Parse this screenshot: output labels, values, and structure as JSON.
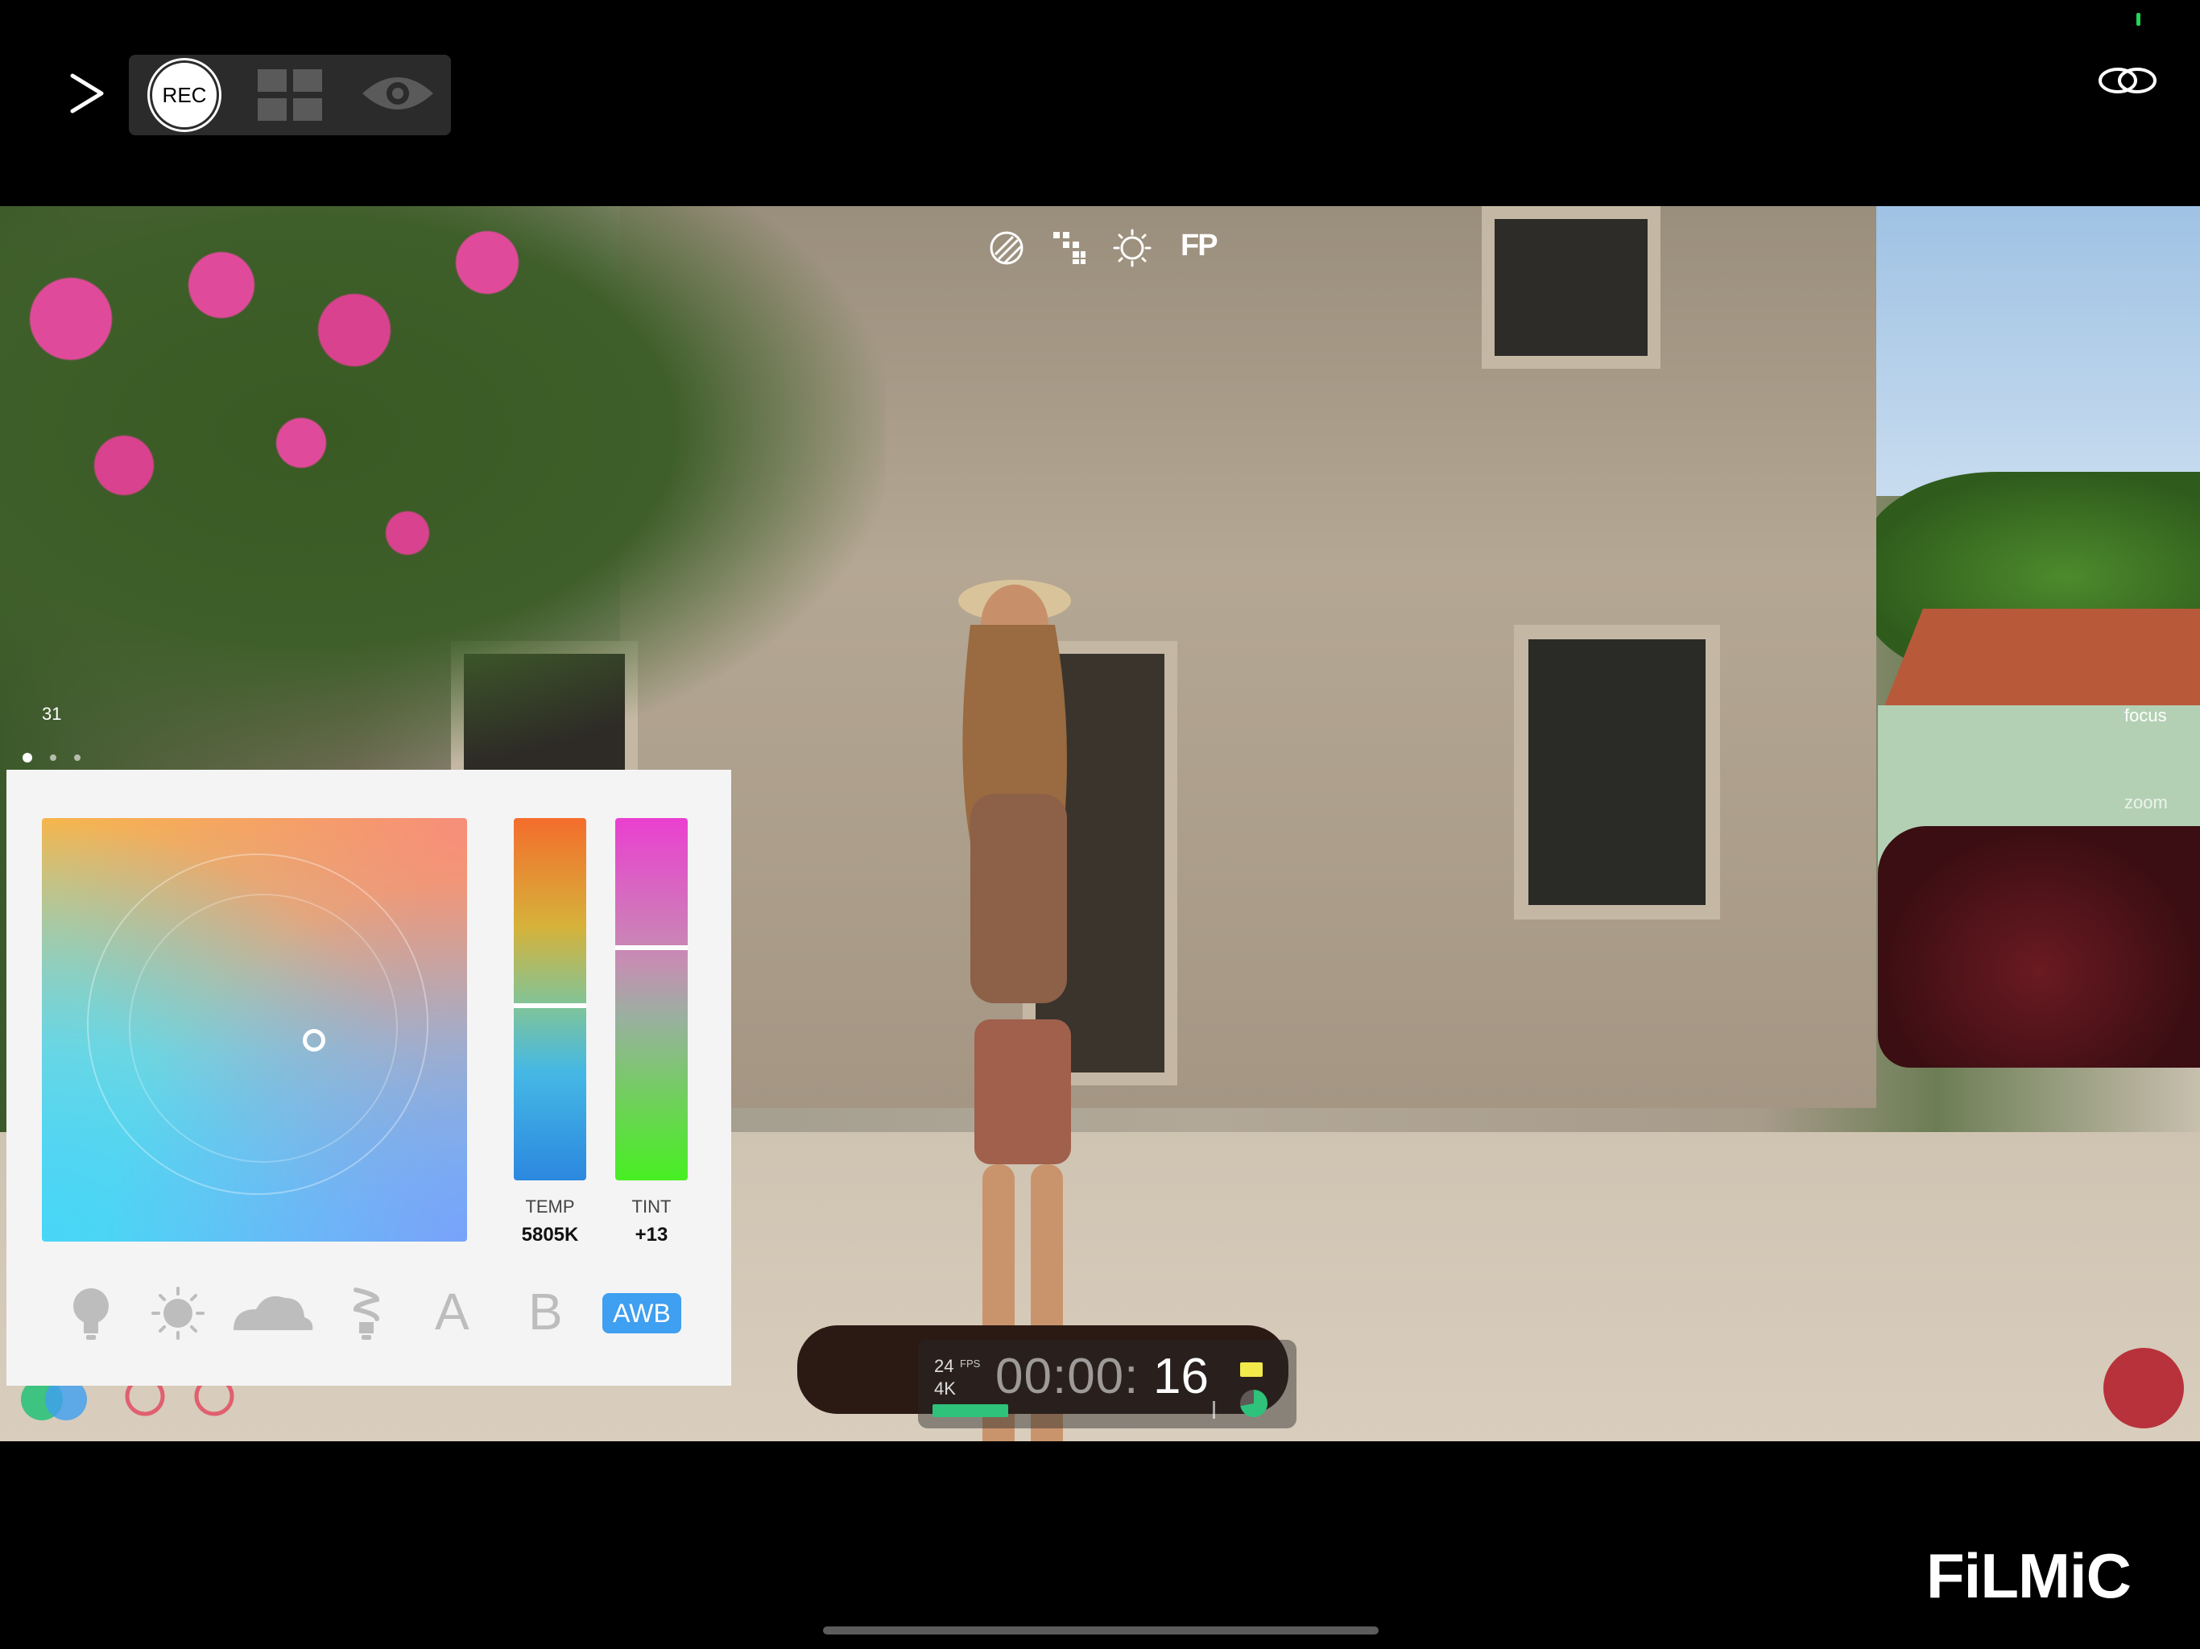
{
  "toolbar": {
    "rec_label": "REC"
  },
  "viewfinder": {
    "fp_label": "FP",
    "counter": "31",
    "focus_label": "focus",
    "zoom_label": "zoom"
  },
  "white_balance": {
    "temp_label": "TEMP",
    "temp_value": "5805K",
    "tint_label": "TINT",
    "tint_value": "+13",
    "preset_a": "A",
    "preset_b": "B",
    "awb_label": "AWB"
  },
  "hud": {
    "fps": "24",
    "fps_unit": "FPS",
    "resolution": "4K",
    "timecode_main": "00:00:",
    "timecode_seconds": "16"
  },
  "brand": {
    "logo": "FiLMiC"
  },
  "colors": {
    "accent": "#3f9ff0",
    "record": "#b8323b",
    "signal": "#1fd655"
  }
}
